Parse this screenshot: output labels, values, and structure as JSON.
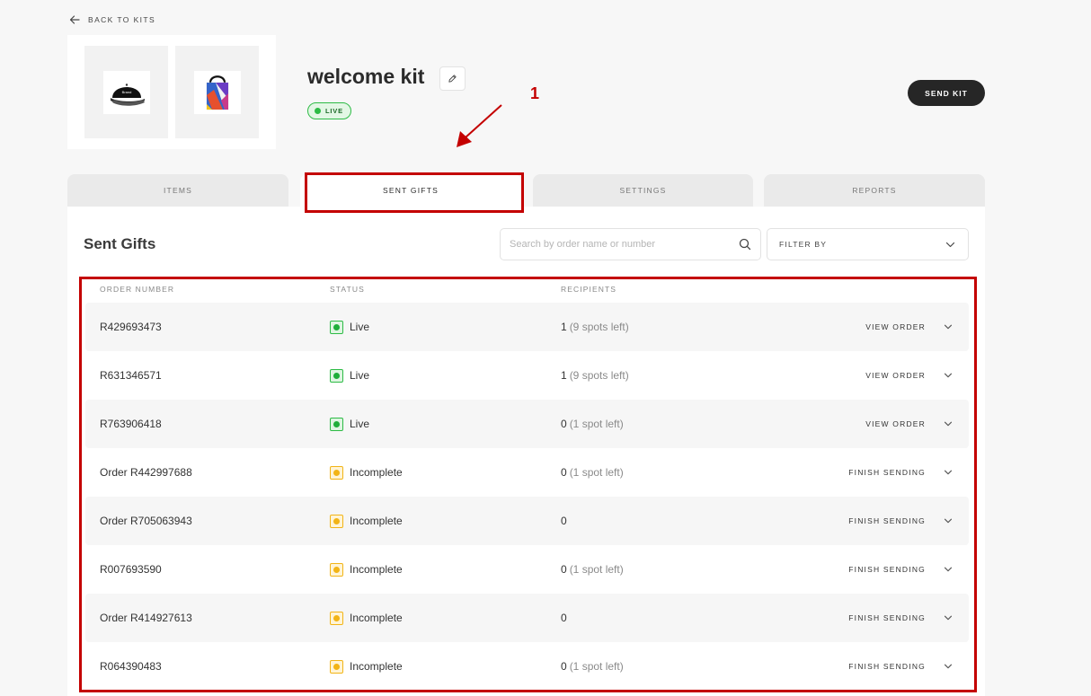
{
  "header": {
    "back_label": "BACK TO KITS",
    "kit_title": "welcome kit",
    "status_pill": "LIVE",
    "send_kit_label": "SEND KIT",
    "hat_brand_text": "Brand"
  },
  "annotation": {
    "number": "1",
    "color": "#c40000"
  },
  "tabs": [
    {
      "label": "ITEMS",
      "active": false
    },
    {
      "label": "SENT GIFTS",
      "active": true
    },
    {
      "label": "SETTINGS",
      "active": false
    },
    {
      "label": "REPORTS",
      "active": false
    }
  ],
  "sent_gifts": {
    "title": "Sent Gifts",
    "search_placeholder": "Search by order name or number",
    "filter_label": "FILTER BY",
    "columns": {
      "order": "ORDER NUMBER",
      "status": "STATUS",
      "recipients": "RECIPIENTS"
    },
    "rows": [
      {
        "order": "R429693473",
        "status": "Live",
        "status_type": "live",
        "recip_count": "1",
        "recip_note": "(9 spots left)",
        "action": "VIEW ORDER"
      },
      {
        "order": "R631346571",
        "status": "Live",
        "status_type": "live",
        "recip_count": "1",
        "recip_note": "(9 spots left)",
        "action": "VIEW ORDER"
      },
      {
        "order": "R763906418",
        "status": "Live",
        "status_type": "live",
        "recip_count": "0",
        "recip_note": "(1 spot left)",
        "action": "VIEW ORDER"
      },
      {
        "order": "Order R442997688",
        "status": "Incomplete",
        "status_type": "incomplete",
        "recip_count": "0",
        "recip_note": "(1 spot left)",
        "action": "FINISH SENDING"
      },
      {
        "order": "Order R705063943",
        "status": "Incomplete",
        "status_type": "incomplete",
        "recip_count": "0",
        "recip_note": "",
        "action": "FINISH SENDING"
      },
      {
        "order": "R007693590",
        "status": "Incomplete",
        "status_type": "incomplete",
        "recip_count": "0",
        "recip_note": "(1 spot left)",
        "action": "FINISH SENDING"
      },
      {
        "order": "Order R414927613",
        "status": "Incomplete",
        "status_type": "incomplete",
        "recip_count": "0",
        "recip_note": "",
        "action": "FINISH SENDING"
      },
      {
        "order": "R064390483",
        "status": "Incomplete",
        "status_type": "incomplete",
        "recip_count": "0",
        "recip_note": "(1 spot left)",
        "action": "FINISH SENDING"
      }
    ]
  },
  "colors": {
    "live_green": "#2dbb45",
    "incomplete_yellow": "#f2b416",
    "dark_button": "#262626"
  }
}
